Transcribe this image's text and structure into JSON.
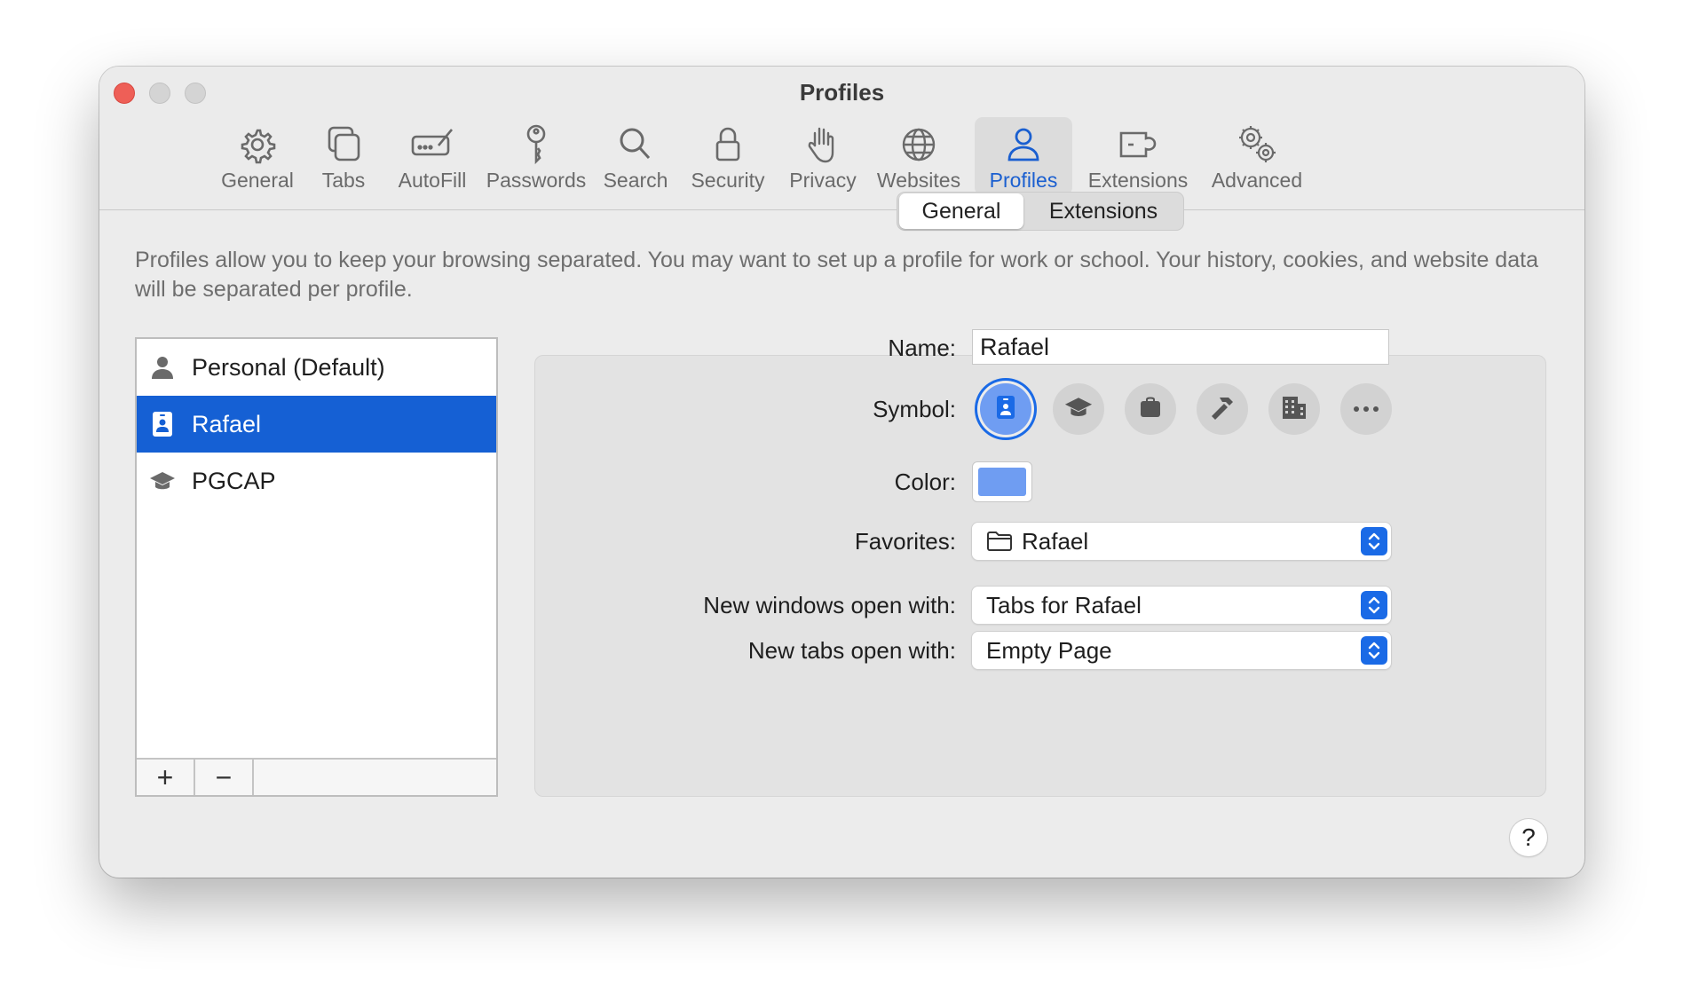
{
  "window": {
    "title": "Profiles"
  },
  "toolbar": {
    "items": [
      {
        "label": "General",
        "icon": "gear-icon"
      },
      {
        "label": "Tabs",
        "icon": "tabs-icon"
      },
      {
        "label": "AutoFill",
        "icon": "autofill-icon"
      },
      {
        "label": "Passwords",
        "icon": "key-icon"
      },
      {
        "label": "Search",
        "icon": "magnifier-icon"
      },
      {
        "label": "Security",
        "icon": "lock-icon"
      },
      {
        "label": "Privacy",
        "icon": "hand-icon"
      },
      {
        "label": "Websites",
        "icon": "globe-icon"
      },
      {
        "label": "Profiles",
        "icon": "person-icon",
        "active": true
      },
      {
        "label": "Extensions",
        "icon": "puzzle-icon"
      },
      {
        "label": "Advanced",
        "icon": "gears-icon"
      }
    ]
  },
  "description": "Profiles allow you to keep your browsing separated. You may want to set up a profile for work or school. Your history, cookies, and website data will be separated per profile.",
  "profiles": {
    "items": [
      {
        "name": "Personal (Default)",
        "icon": "person-icon"
      },
      {
        "name": "Rafael",
        "icon": "id-badge-icon",
        "selected": true
      },
      {
        "name": "PGCAP",
        "icon": "graduation-cap-icon"
      }
    ],
    "add_label": "+",
    "remove_label": "−"
  },
  "tabs": {
    "general": "General",
    "extensions": "Extensions",
    "selected": "General"
  },
  "form": {
    "name_label": "Name:",
    "name_value": "Rafael",
    "symbol_label": "Symbol:",
    "symbols": [
      "id-badge-icon",
      "graduation-cap-icon",
      "bag-icon",
      "hammer-icon",
      "building-icon",
      "more-icon"
    ],
    "selected_symbol": "id-badge-icon",
    "color_label": "Color:",
    "color_value": "#6f9df2",
    "favorites_label": "Favorites:",
    "favorites_value": "Rafael",
    "new_windows_label": "New windows open with:",
    "new_windows_value": "Tabs for Rafael",
    "new_tabs_label": "New tabs open with:",
    "new_tabs_value": "Empty Page"
  },
  "help_label": "?",
  "colors": {
    "accent": "#1a6ae6",
    "selection": "#1560d4",
    "close": "#ee5f57"
  }
}
